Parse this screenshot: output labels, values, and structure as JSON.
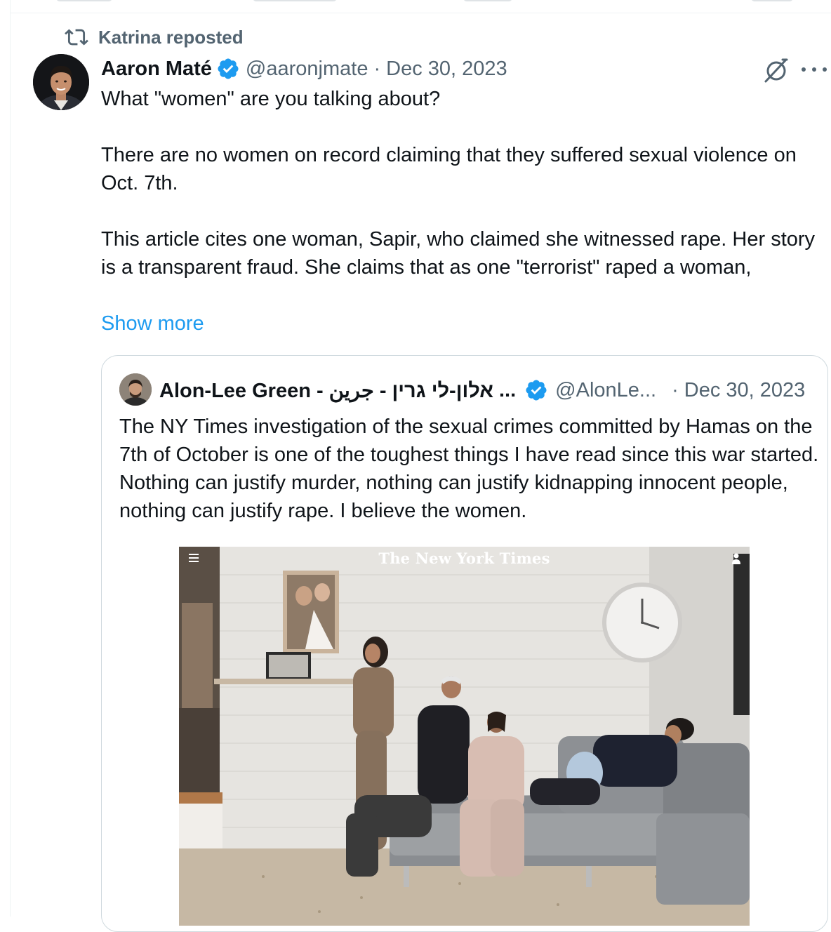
{
  "repost": {
    "icon": "repost-icon",
    "label": "Katrina reposted"
  },
  "tweet": {
    "author_name": "Aaron Maté",
    "verified_icon": "verified-badge-icon",
    "handle": "@aaronjmate",
    "separator": "·",
    "date": "Dec 30, 2023",
    "grok_icon": "grok-icon",
    "more_icon": "more-options-icon",
    "paragraphs": [
      "What \"women\" are you talking about?",
      "There are no women on record claiming that they suffered sexual violence on Oct. 7th.",
      "This article cites one woman, Sapir, who claimed she witnessed rape. Her story is a transparent fraud. She claims that as one \"terrorist\" raped a woman,"
    ],
    "show_more": "Show more"
  },
  "quote": {
    "author_name": "Alon-Lee Green - אלון-לי גרין - جرين",
    "name_ellipsis": "...",
    "handle": "@AlonLe...",
    "separator": "·",
    "date": "Dec 30, 2023",
    "text": "The NY Times investigation of the sexual crimes committed by Hamas on the 7th of October is one of the toughest things I have read since this war started. Nothing can justify murder, nothing can justify kidnapping innocent people, nothing can justify rape. I believe the women.",
    "image": {
      "masthead": "The New York Times"
    }
  },
  "colors": {
    "text": "#0f1419",
    "secondary": "#536471",
    "accent": "#1d9bf0",
    "border": "#cfd9de"
  }
}
